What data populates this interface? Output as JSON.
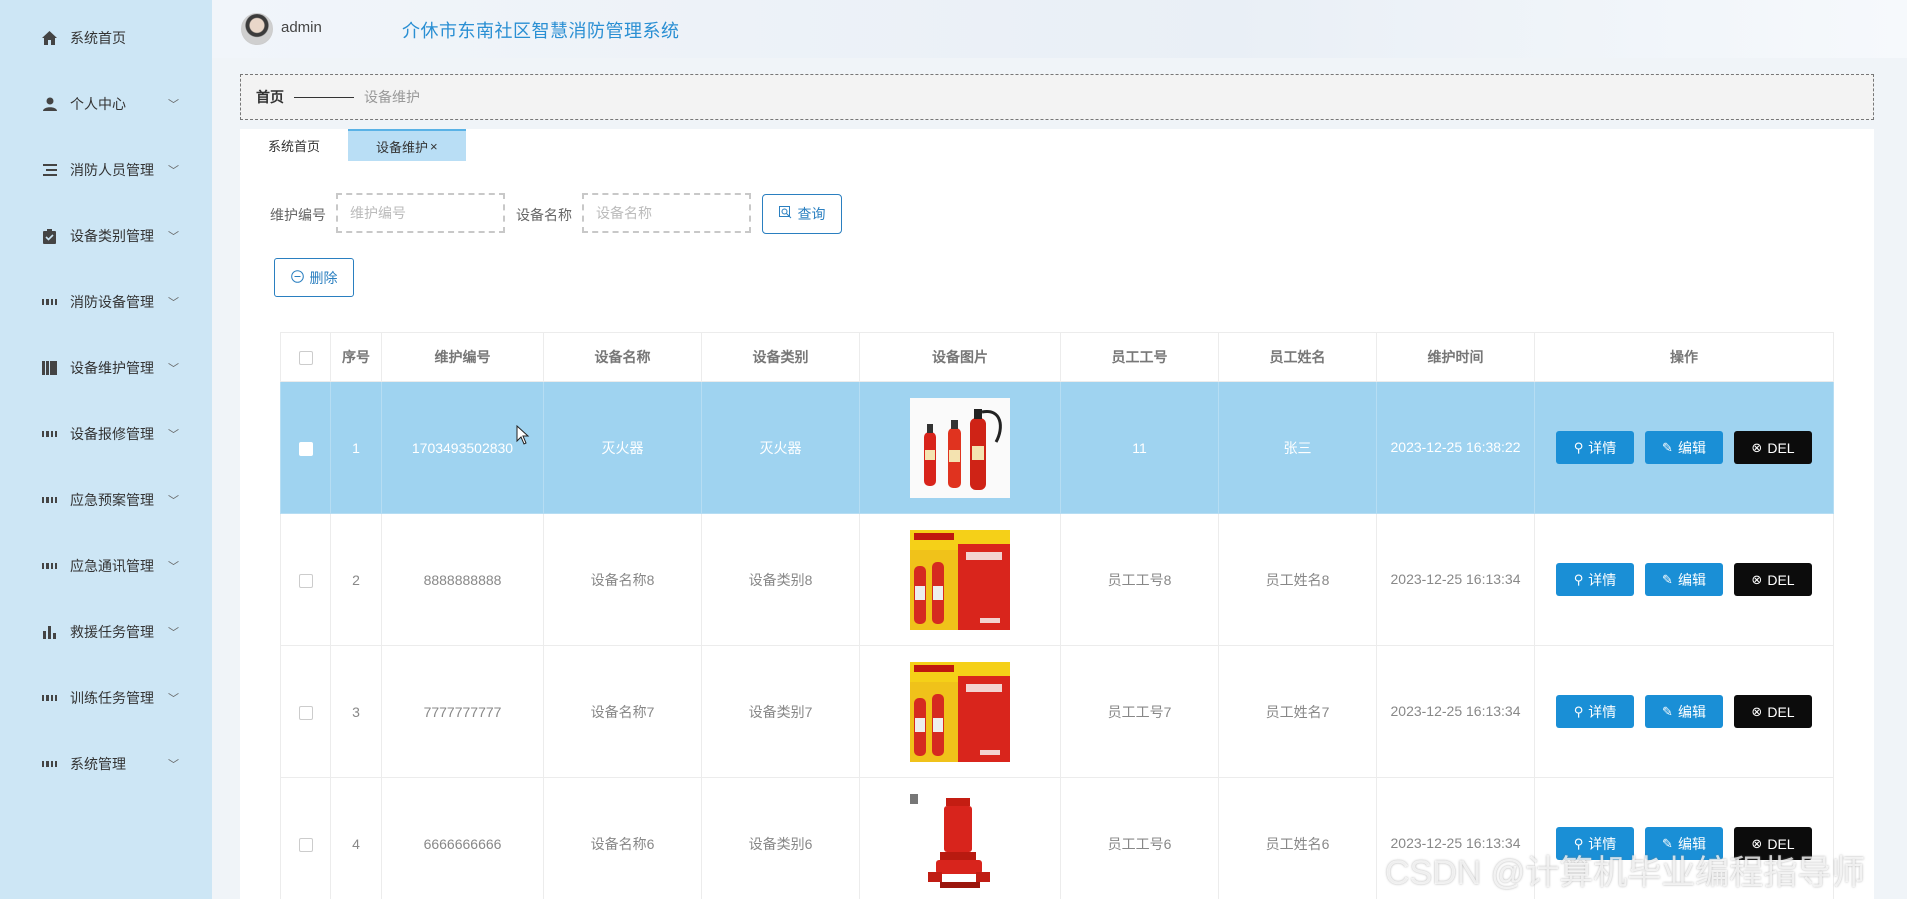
{
  "sidebar": {
    "items": [
      {
        "label": "系统首页",
        "icon": "home-icon",
        "has_children": false
      },
      {
        "label": "个人中心",
        "icon": "user-icon",
        "has_children": true
      },
      {
        "label": "消防人员管理",
        "icon": "list-icon",
        "has_children": true
      },
      {
        "label": "设备类别管理",
        "icon": "clipboard-icon",
        "has_children": true
      },
      {
        "label": "消防设备管理",
        "icon": "grid-icon",
        "has_children": true
      },
      {
        "label": "设备维护管理",
        "icon": "book-icon",
        "has_children": true
      },
      {
        "label": "设备报修管理",
        "icon": "grid-icon",
        "has_children": true
      },
      {
        "label": "应急预案管理",
        "icon": "grid-icon",
        "has_children": true
      },
      {
        "label": "应急通讯管理",
        "icon": "grid-icon",
        "has_children": true
      },
      {
        "label": "救援任务管理",
        "icon": "bar-chart-icon",
        "has_children": true
      },
      {
        "label": "训练任务管理",
        "icon": "grid-icon",
        "has_children": true
      },
      {
        "label": "系统管理",
        "icon": "grid-icon",
        "has_children": true
      }
    ]
  },
  "header": {
    "username": "admin",
    "title": "介休市东南社区智慧消防管理系统"
  },
  "breadcrumb": {
    "home": "首页",
    "current": "设备维护"
  },
  "tabs": [
    {
      "label": "系统首页",
      "active": false
    },
    {
      "label": "设备维护",
      "active": true,
      "close": "×"
    }
  ],
  "search": {
    "field1_label": "维护编号",
    "field1_placeholder": "维护编号",
    "field2_label": "设备名称",
    "field2_placeholder": "设备名称",
    "query_button": "查询",
    "delete_button": "删除"
  },
  "table": {
    "headers": [
      "序号",
      "维护编号",
      "设备名称",
      "设备类别",
      "设备图片",
      "员工工号",
      "员工姓名",
      "维护时间",
      "操作"
    ],
    "actions": {
      "detail": "详情",
      "edit": "编辑",
      "del": "DEL"
    },
    "rows": [
      {
        "index": "1",
        "code": "1703493502830",
        "name": "灭火器",
        "category": "灭火器",
        "image": "fire-extinguishers-photo",
        "emp_no": "11",
        "emp_name": "张三",
        "time": "2023-12-25 16:38:22",
        "selected": true
      },
      {
        "index": "2",
        "code": "8888888888",
        "name": "设备名称8",
        "category": "设备类别8",
        "image": "extinguisher-kit-photo",
        "emp_no": "员工工号8",
        "emp_name": "员工姓名8",
        "time": "2023-12-25 16:13:34",
        "selected": false
      },
      {
        "index": "3",
        "code": "7777777777",
        "name": "设备名称7",
        "category": "设备类别7",
        "image": "extinguisher-kit-photo",
        "emp_no": "员工工号7",
        "emp_name": "员工姓名7",
        "time": "2023-12-25 16:13:34",
        "selected": false
      },
      {
        "index": "4",
        "code": "6666666666",
        "name": "设备名称6",
        "category": "设备类别6",
        "image": "fire-pump-photo",
        "emp_no": "员工工号6",
        "emp_name": "员工姓名6",
        "time": "2023-12-25 16:13:34",
        "selected": false
      }
    ]
  },
  "watermark": "CSDN @计算机毕业编程指导师",
  "colors": {
    "sidebar_bg": "#cde6f5",
    "title": "#2a8fd3",
    "selected_row": "#9fd3f0",
    "action_blue": "#1a8fd6",
    "action_black": "#0c0c0c"
  }
}
